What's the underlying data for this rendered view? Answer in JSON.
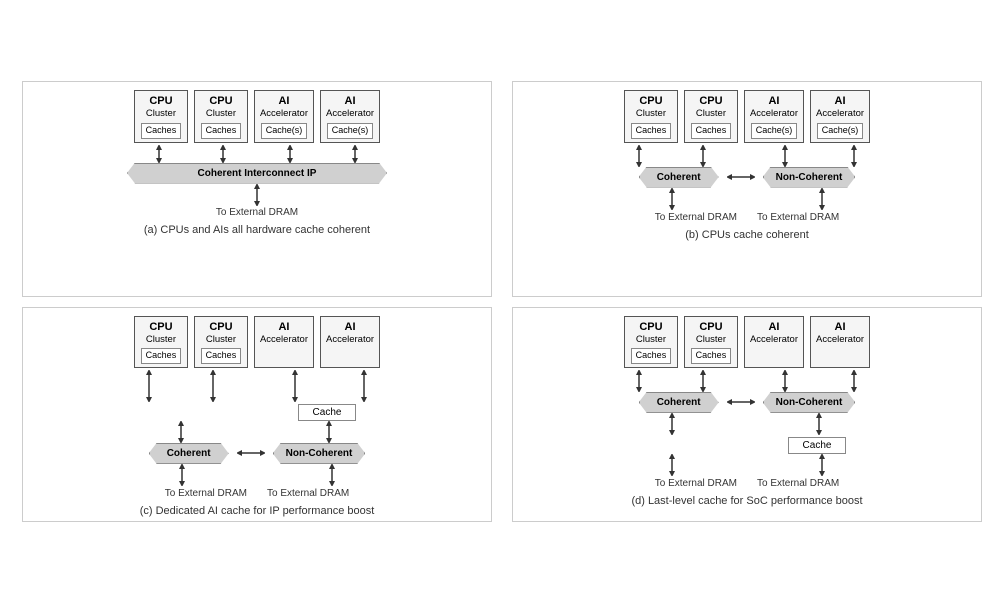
{
  "diagrams": [
    {
      "id": "a",
      "title": "(a) CPUs and AIs all hardware cache coherent",
      "nodes": [
        {
          "type": "CPU",
          "sub": "Cluster",
          "cache": "Caches"
        },
        {
          "type": "CPU",
          "sub": "Cluster",
          "cache": "Caches"
        },
        {
          "type": "AI",
          "sub": "Accelerator",
          "cache": "Cache(s)"
        },
        {
          "type": "AI",
          "sub": "Accelerator",
          "cache": "Cache(s)"
        }
      ],
      "interconnect": "Coherent Interconnect IP",
      "dram": [
        "To External DRAM"
      ]
    },
    {
      "id": "b",
      "title": "(b) CPUs cache coherent",
      "nodes": [
        {
          "type": "CPU",
          "sub": "Cluster",
          "cache": "Caches"
        },
        {
          "type": "CPU",
          "sub": "Cluster",
          "cache": "Caches"
        },
        {
          "type": "AI",
          "sub": "Accelerator",
          "cache": "Cache(s)"
        },
        {
          "type": "AI",
          "sub": "Accelerator",
          "cache": "Cache(s)"
        }
      ],
      "interconnect_left": "Coherent",
      "interconnect_right": "Non-Coherent",
      "dram": [
        "To External DRAM",
        "To External DRAM"
      ]
    },
    {
      "id": "c",
      "title": "(c) Dedicated AI cache for IP performance boost",
      "nodes": [
        {
          "type": "CPU",
          "sub": "Cluster",
          "cache": "Caches"
        },
        {
          "type": "CPU",
          "sub": "Cluster",
          "cache": "Caches"
        },
        {
          "type": "AI",
          "sub": "Accelerator",
          "cache": null
        },
        {
          "type": "AI",
          "sub": "Accelerator",
          "cache": null
        }
      ],
      "ai_cache": "Cache",
      "interconnect_left": "Coherent",
      "interconnect_right": "Non-Coherent",
      "dram": [
        "To External DRAM",
        "To External DRAM"
      ]
    },
    {
      "id": "d",
      "title": "(d) Last-level cache for SoC performance boost",
      "nodes": [
        {
          "type": "CPU",
          "sub": "Cluster",
          "cache": "Caches"
        },
        {
          "type": "CPU",
          "sub": "Cluster",
          "cache": "Caches"
        },
        {
          "type": "AI",
          "sub": "Accelerator",
          "cache": null
        },
        {
          "type": "AI",
          "sub": "Accelerator",
          "cache": null
        }
      ],
      "llc_cache": "Cache",
      "interconnect_left": "Coherent",
      "interconnect_right": "Non-Coherent",
      "dram": [
        "To External DRAM",
        "To External DRAM"
      ]
    }
  ]
}
